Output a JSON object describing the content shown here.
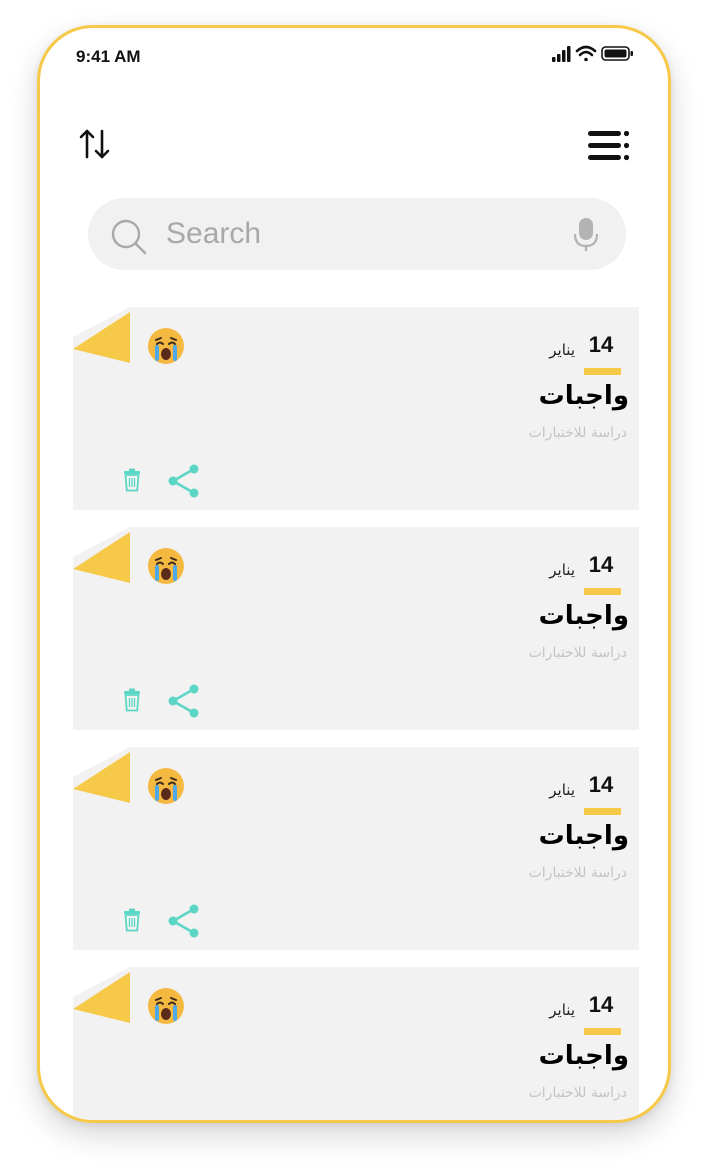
{
  "status_bar": {
    "time": "9:41 AM",
    "icons": [
      "signal-icon",
      "wifi-icon",
      "battery-icon"
    ]
  },
  "toolbar": {
    "sort_icon": "sort-arrows-icon",
    "menu_icon": "menu-icon"
  },
  "search": {
    "placeholder": "Search",
    "value": "",
    "icons": [
      "search-icon",
      "microphone-icon"
    ]
  },
  "notes": [
    {
      "day": "14",
      "month": "يناير",
      "title": "واجبات",
      "subtitle": "دراسة للاختبارات",
      "emoji": "crying-face-icon",
      "actions": [
        "trash-icon",
        "share-icon"
      ]
    },
    {
      "day": "14",
      "month": "يناير",
      "title": "واجبات",
      "subtitle": "دراسة للاختبارات",
      "emoji": "crying-face-icon",
      "actions": [
        "trash-icon",
        "share-icon"
      ]
    },
    {
      "day": "14",
      "month": "يناير",
      "title": "واجبات",
      "subtitle": "دراسة للاختبارات",
      "emoji": "crying-face-icon",
      "actions": [
        "trash-icon",
        "share-icon"
      ]
    },
    {
      "day": "14",
      "month": "يناير",
      "title": "واجبات",
      "subtitle": "دراسة للاختبارات",
      "emoji": "crying-face-icon",
      "actions": []
    }
  ],
  "colors": {
    "accent": "#f7c948",
    "action_teal": "#5cd6c4",
    "card_background": "#f2f2f2",
    "search_background": "#f1f1f1",
    "subtitle_gray": "#c4c4c4"
  }
}
